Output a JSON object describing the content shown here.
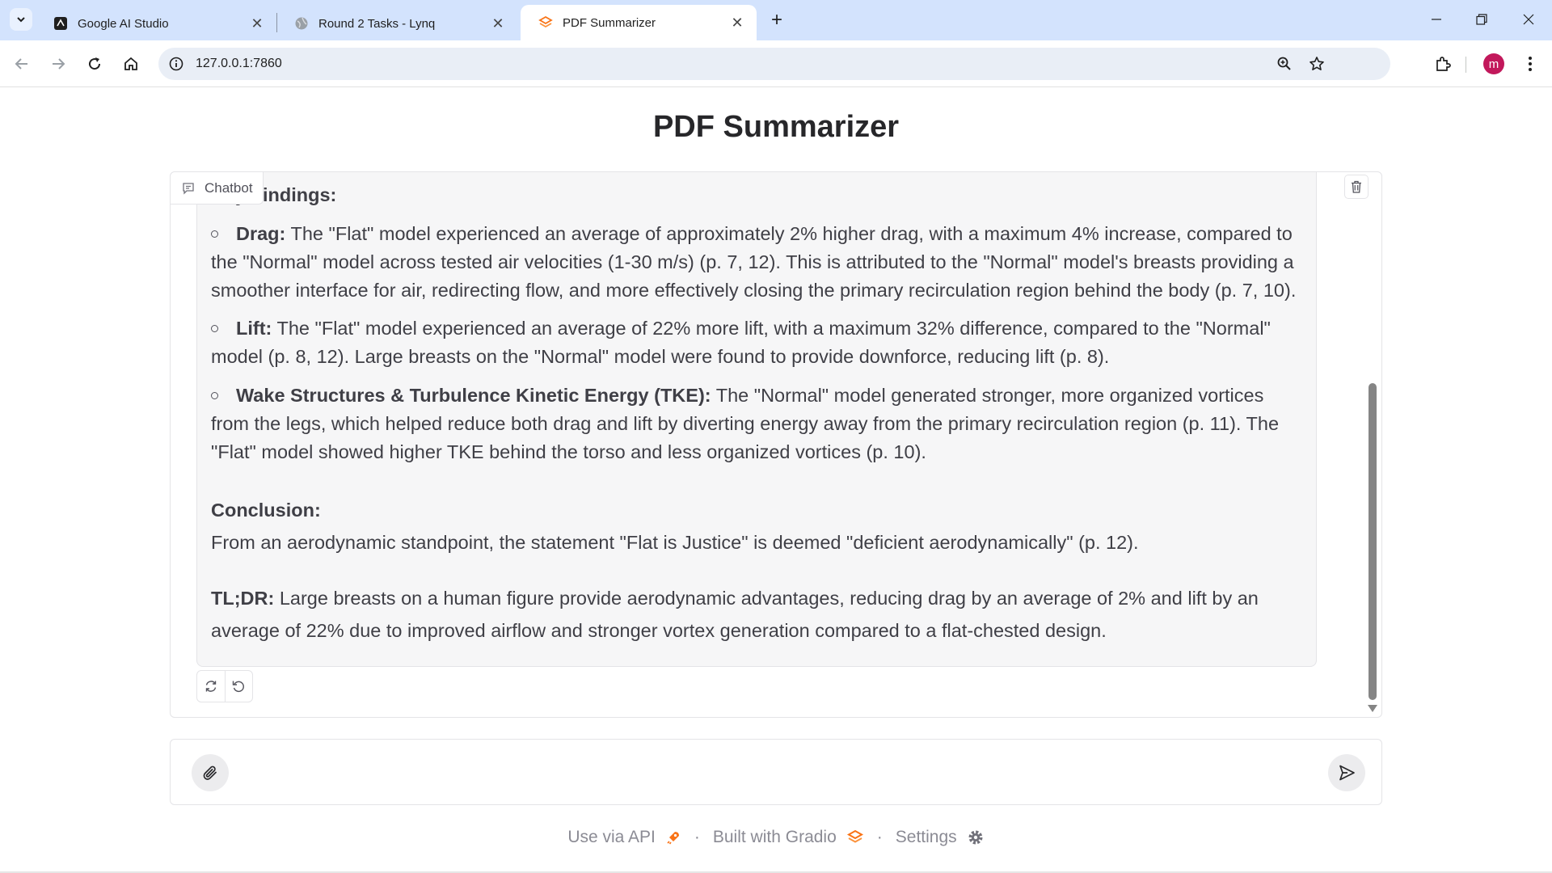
{
  "browser": {
    "tabs": [
      {
        "title": "Google AI Studio",
        "icon": "ai-studio-icon",
        "active": false
      },
      {
        "title": "Round 2 Tasks - Lynq",
        "icon": "globe-icon",
        "active": false
      },
      {
        "title": "PDF Summarizer",
        "icon": "gradio-logo-icon",
        "active": true
      }
    ],
    "url": "127.0.0.1:7860",
    "profile_initial": "m",
    "profile_color": "#c2185b"
  },
  "page": {
    "title": "PDF Summarizer"
  },
  "chatbot": {
    "label": "Chatbot",
    "message": {
      "key_findings_heading": "Key Findings:",
      "bullets": [
        {
          "term": "Drag:",
          "text": " The \"Flat\" model experienced an average of approximately 2% higher drag, with a maximum 4% increase, compared to the \"Normal\" model across tested air velocities (1-30 m/s) (p. 7, 12). This is attributed to the \"Normal\" model's breasts providing a smoother interface for air, redirecting flow, and more effectively closing the primary recirculation region behind the body (p. 7, 10)."
        },
        {
          "term": "Lift:",
          "text": " The \"Flat\" model experienced an average of 22% more lift, with a maximum 32% difference, compared to the \"Normal\" model (p. 8, 12). Large breasts on the \"Normal\" model were found to provide downforce, reducing lift (p. 8)."
        },
        {
          "term": "Wake Structures & Turbulence Kinetic Energy (TKE):",
          "text": " The \"Normal\" model generated stronger, more organized vortices from the legs, which helped reduce both drag and lift by diverting energy away from the primary recirculation region (p. 11). The \"Flat\" model showed higher TKE behind the torso and less organized vortices (p. 10)."
        }
      ],
      "conclusion_heading": "Conclusion:",
      "conclusion_text": "From an aerodynamic standpoint, the statement \"Flat is Justice\" is deemed \"deficient aerodynamically\" (p. 12).",
      "tldr_label": "TL;DR:",
      "tldr_text": " Large breasts on a human figure provide aerodynamic advantages, reducing drag by an average of 2% and lift by an average of 22% due to improved airflow and stronger vortex generation compared to a flat-chested design."
    }
  },
  "input": {
    "value": "",
    "placeholder": ""
  },
  "footer": {
    "api_label": "Use via API",
    "built_label": "Built with Gradio",
    "settings_label": "Settings",
    "separator": "·"
  },
  "colors": {
    "tabstrip": "#d3e3fd",
    "gradio_orange": "#f97316"
  }
}
